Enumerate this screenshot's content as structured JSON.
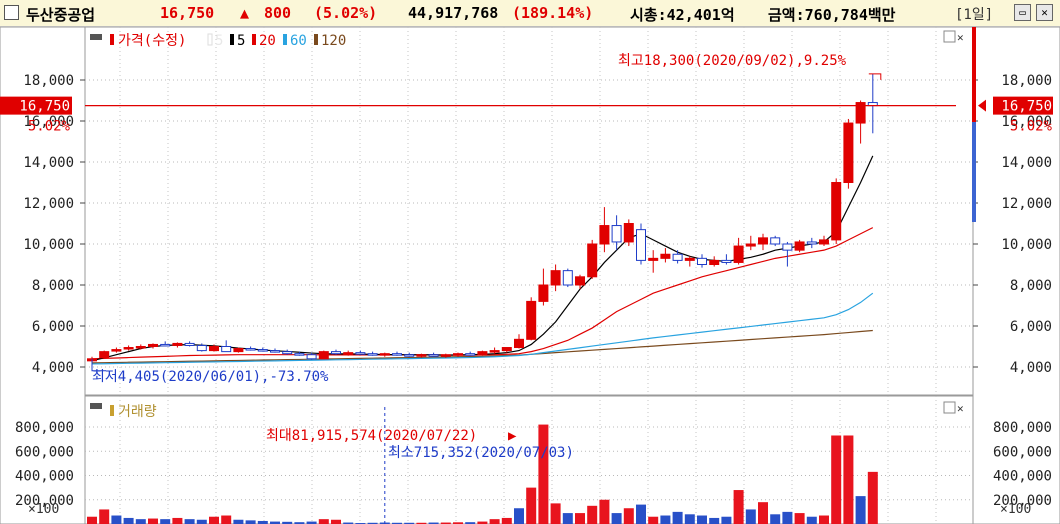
{
  "header": {
    "name": "두산중공업",
    "price": "16,750",
    "change_arrow": "▲",
    "change": "800",
    "change_pct": "(5.02%)",
    "volume": "44,917,768",
    "volume_ratio": "(189.14%)",
    "market_cap": "시총:42,401억",
    "amount": "금액:760,784백만",
    "period": "[1일]",
    "colors": {
      "up": "#e00000",
      "down": "#1e3cc8",
      "text": "#000000"
    }
  },
  "price_panel": {
    "legend": {
      "title": "가격(수정)",
      "ma": [
        {
          "label": "5",
          "color": "#ffffff"
        },
        {
          "label": "5",
          "color": "#000000"
        },
        {
          "label": "20",
          "color": "#e00000"
        },
        {
          "label": "60",
          "color": "#29a3e0"
        },
        {
          "label": "120",
          "color": "#7a4a1e"
        }
      ]
    },
    "y_ticks": [
      "18,000",
      "16,000",
      "14,000",
      "12,000",
      "10,000",
      "8,000",
      "6,000",
      "4,000"
    ],
    "current_price_label": "16,750",
    "current_pct_label": "5.02%",
    "high_annotation": "최고18,300(2020/09/02),9.25%",
    "low_annotation": "최저4,405(2020/06/01),-73.70%"
  },
  "volume_panel": {
    "legend": "거래량",
    "y_ticks": [
      "800,000",
      "600,000",
      "400,000",
      "200,000"
    ],
    "unit": "×100",
    "max_annotation": "최대81,915,574(2020/07/22)",
    "min_annotation": "최소715,352(2020/07/03)"
  },
  "chart_data": {
    "type": "candlestick",
    "ylim": [
      3500,
      19000
    ],
    "grid": true,
    "candles": [
      {
        "o": 4300,
        "h": 4500,
        "l": 4250,
        "c": 4400
      },
      {
        "o": 4450,
        "h": 4800,
        "l": 4400,
        "c": 4750
      },
      {
        "o": 4800,
        "h": 4950,
        "l": 4700,
        "c": 4850
      },
      {
        "o": 4900,
        "h": 5050,
        "l": 4800,
        "c": 4950
      },
      {
        "o": 4950,
        "h": 5100,
        "l": 4850,
        "c": 5000
      },
      {
        "o": 5000,
        "h": 5150,
        "l": 4900,
        "c": 5100
      },
      {
        "o": 5100,
        "h": 5250,
        "l": 5000,
        "c": 5050
      },
      {
        "o": 5050,
        "h": 5200,
        "l": 4950,
        "c": 5150
      },
      {
        "o": 5150,
        "h": 5250,
        "l": 5000,
        "c": 5050
      },
      {
        "o": 5050,
        "h": 5150,
        "l": 4750,
        "c": 4800
      },
      {
        "o": 4800,
        "h": 5100,
        "l": 4750,
        "c": 5000
      },
      {
        "o": 5000,
        "h": 5300,
        "l": 4950,
        "c": 4750
      },
      {
        "o": 4750,
        "h": 4950,
        "l": 4700,
        "c": 4900
      },
      {
        "o": 4900,
        "h": 5000,
        "l": 4800,
        "c": 4850
      },
      {
        "o": 4850,
        "h": 4950,
        "l": 4750,
        "c": 4800
      },
      {
        "o": 4800,
        "h": 4900,
        "l": 4700,
        "c": 4750
      },
      {
        "o": 4750,
        "h": 4850,
        "l": 4600,
        "c": 4650
      },
      {
        "o": 4650,
        "h": 4750,
        "l": 4550,
        "c": 4600
      },
      {
        "o": 4600,
        "h": 4700,
        "l": 4350,
        "c": 4400
      },
      {
        "o": 4400,
        "h": 4800,
        "l": 4380,
        "c": 4750
      },
      {
        "o": 4750,
        "h": 4850,
        "l": 4600,
        "c": 4650
      },
      {
        "o": 4650,
        "h": 4800,
        "l": 4550,
        "c": 4700
      },
      {
        "o": 4700,
        "h": 4800,
        "l": 4600,
        "c": 4650
      },
      {
        "o": 4650,
        "h": 4750,
        "l": 4550,
        "c": 4600
      },
      {
        "o": 4600,
        "h": 4700,
        "l": 4500,
        "c": 4650
      },
      {
        "o": 4650,
        "h": 4750,
        "l": 4550,
        "c": 4600
      },
      {
        "o": 4600,
        "h": 4700,
        "l": 4500,
        "c": 4550
      },
      {
        "o": 4550,
        "h": 4650,
        "l": 4450,
        "c": 4600
      },
      {
        "o": 4600,
        "h": 4700,
        "l": 4500,
        "c": 4550
      },
      {
        "o": 4550,
        "h": 4650,
        "l": 4450,
        "c": 4600
      },
      {
        "o": 4600,
        "h": 4700,
        "l": 4500,
        "c": 4650
      },
      {
        "o": 4650,
        "h": 4750,
        "l": 4550,
        "c": 4600
      },
      {
        "o": 4600,
        "h": 4800,
        "l": 4550,
        "c": 4750
      },
      {
        "o": 4750,
        "h": 4950,
        "l": 4650,
        "c": 4800
      },
      {
        "o": 4800,
        "h": 4900,
        "l": 4700,
        "c": 4950
      },
      {
        "o": 4950,
        "h": 5600,
        "l": 4900,
        "c": 5350
      },
      {
        "o": 5350,
        "h": 7400,
        "l": 5300,
        "c": 7200
      },
      {
        "o": 7200,
        "h": 8800,
        "l": 7000,
        "c": 8000
      },
      {
        "o": 8000,
        "h": 9000,
        "l": 7700,
        "c": 8700
      },
      {
        "o": 8700,
        "h": 8800,
        "l": 7900,
        "c": 8000
      },
      {
        "o": 8000,
        "h": 8500,
        "l": 7800,
        "c": 8400
      },
      {
        "o": 8400,
        "h": 10200,
        "l": 8300,
        "c": 10000
      },
      {
        "o": 10000,
        "h": 11800,
        "l": 9600,
        "c": 10900
      },
      {
        "o": 10900,
        "h": 11400,
        "l": 9700,
        "c": 10100
      },
      {
        "o": 10100,
        "h": 11200,
        "l": 9900,
        "c": 11000
      },
      {
        "o": 10700,
        "h": 11000,
        "l": 9000,
        "c": 9200
      },
      {
        "o": 9200,
        "h": 9700,
        "l": 8600,
        "c": 9300
      },
      {
        "o": 9300,
        "h": 9800,
        "l": 9100,
        "c": 9500
      },
      {
        "o": 9500,
        "h": 9700,
        "l": 9050,
        "c": 9200
      },
      {
        "o": 9200,
        "h": 9400,
        "l": 8900,
        "c": 9300
      },
      {
        "o": 9300,
        "h": 9500,
        "l": 8850,
        "c": 9000
      },
      {
        "o": 9000,
        "h": 9400,
        "l": 8900,
        "c": 9200
      },
      {
        "o": 9200,
        "h": 9500,
        "l": 9000,
        "c": 9100
      },
      {
        "o": 9100,
        "h": 10300,
        "l": 9000,
        "c": 9900
      },
      {
        "o": 9900,
        "h": 10400,
        "l": 9700,
        "c": 10000
      },
      {
        "o": 10000,
        "h": 10500,
        "l": 9700,
        "c": 10300
      },
      {
        "o": 10300,
        "h": 10400,
        "l": 9900,
        "c": 10000
      },
      {
        "o": 10000,
        "h": 10100,
        "l": 8900,
        "c": 9700
      },
      {
        "o": 9700,
        "h": 10200,
        "l": 9600,
        "c": 10100
      },
      {
        "o": 10100,
        "h": 10300,
        "l": 9800,
        "c": 10000
      },
      {
        "o": 10000,
        "h": 10400,
        "l": 9900,
        "c": 10200
      },
      {
        "o": 10200,
        "h": 13200,
        "l": 10000,
        "c": 13000
      },
      {
        "o": 13000,
        "h": 16100,
        "l": 12700,
        "c": 15900
      },
      {
        "o": 15900,
        "h": 17000,
        "l": 14900,
        "c": 16900
      },
      {
        "o": 16900,
        "h": 18300,
        "l": 15400,
        "c": 16750
      }
    ],
    "ma5": [
      4300,
      4450,
      4600,
      4750,
      4900,
      5000,
      5050,
      5080,
      5090,
      5060,
      5030,
      4980,
      4920,
      4880,
      4830,
      4790,
      4760,
      4720,
      4680,
      4650,
      4640,
      4640,
      4630,
      4620,
      4610,
      4600,
      4600,
      4590,
      4590,
      4580,
      4590,
      4600,
      4620,
      4650,
      4700,
      4800,
      5100,
      5600,
      6200,
      7000,
      7800,
      8400,
      9100,
      9700,
      10300,
      10500,
      10200,
      9900,
      9600,
      9400,
      9250,
      9200,
      9150,
      9250,
      9350,
      9500,
      9700,
      9800,
      9900,
      10000,
      10100,
      10600,
      11800,
      13000,
      14300
    ],
    "ma20": [
      4400,
      4420,
      4440,
      4460,
      4480,
      4500,
      4520,
      4540,
      4560,
      4570,
      4580,
      4590,
      4600,
      4600,
      4600,
      4600,
      4600,
      4600,
      4600,
      4590,
      4590,
      4590,
      4590,
      4590,
      4590,
      4590,
      4590,
      4590,
      4590,
      4580,
      4580,
      4580,
      4590,
      4600,
      4620,
      4650,
      4750,
      4900,
      5100,
      5300,
      5600,
      5900,
      6300,
      6700,
      7000,
      7300,
      7600,
      7800,
      8000,
      8200,
      8400,
      8550,
      8700,
      8850,
      9000,
      9150,
      9300,
      9400,
      9500,
      9600,
      9700,
      9900,
      10200,
      10500,
      10800
    ],
    "ma60": [
      4150,
      4160,
      4170,
      4180,
      4190,
      4200,
      4210,
      4220,
      4230,
      4240,
      4250,
      4260,
      4270,
      4280,
      4290,
      4300,
      4310,
      4320,
      4330,
      4340,
      4350,
      4360,
      4370,
      4380,
      4390,
      4400,
      4410,
      4420,
      4430,
      4440,
      4450,
      4460,
      4480,
      4500,
      4530,
      4560,
      4620,
      4700,
      4780,
      4860,
      4940,
      5020,
      5100,
      5180,
      5260,
      5340,
      5420,
      5490,
      5560,
      5630,
      5700,
      5770,
      5840,
      5910,
      5980,
      6050,
      6120,
      6190,
      6260,
      6330,
      6400,
      6550,
      6800,
      7150,
      7600
    ],
    "ma120": [
      4200,
      4210,
      4220,
      4230,
      4240,
      4250,
      4260,
      4270,
      4280,
      4290,
      4300,
      4310,
      4320,
      4330,
      4340,
      4350,
      4360,
      4370,
      4380,
      4390,
      4400,
      4410,
      4420,
      4430,
      4440,
      4450,
      4460,
      4470,
      4480,
      4490,
      4500,
      4510,
      4520,
      4540,
      4560,
      4580,
      4620,
      4660,
      4700,
      4740,
      4780,
      4820,
      4860,
      4900,
      4940,
      4980,
      5020,
      5060,
      5100,
      5140,
      5180,
      5220,
      5260,
      5300,
      5340,
      5380,
      5420,
      5460,
      5500,
      5540,
      5580,
      5630,
      5680,
      5730,
      5780
    ],
    "volume_ylim": [
      0,
      900000
    ],
    "volume": [
      {
        "v": 60000,
        "up": true
      },
      {
        "v": 120000,
        "up": true
      },
      {
        "v": 70000,
        "up": false
      },
      {
        "v": 50000,
        "up": false
      },
      {
        "v": 40000,
        "up": false
      },
      {
        "v": 45000,
        "up": true
      },
      {
        "v": 40000,
        "up": false
      },
      {
        "v": 50000,
        "up": true
      },
      {
        "v": 40000,
        "up": false
      },
      {
        "v": 35000,
        "up": false
      },
      {
        "v": 60000,
        "up": true
      },
      {
        "v": 70000,
        "up": true
      },
      {
        "v": 35000,
        "up": false
      },
      {
        "v": 30000,
        "up": false
      },
      {
        "v": 25000,
        "up": false
      },
      {
        "v": 20000,
        "up": false
      },
      {
        "v": 18000,
        "up": false
      },
      {
        "v": 15000,
        "up": false
      },
      {
        "v": 20000,
        "up": false
      },
      {
        "v": 40000,
        "up": true
      },
      {
        "v": 35000,
        "up": true
      },
      {
        "v": 12000,
        "up": false
      },
      {
        "v": 8000,
        "up": false
      },
      {
        "v": 10000,
        "up": false
      },
      {
        "v": 12000,
        "up": false
      },
      {
        "v": 10000,
        "up": false
      },
      {
        "v": 10000,
        "up": false
      },
      {
        "v": 10000,
        "up": true
      },
      {
        "v": 12000,
        "up": false
      },
      {
        "v": 12000,
        "up": true
      },
      {
        "v": 14000,
        "up": true
      },
      {
        "v": 15000,
        "up": false
      },
      {
        "v": 20000,
        "up": true
      },
      {
        "v": 40000,
        "up": true
      },
      {
        "v": 50000,
        "up": true
      },
      {
        "v": 130000,
        "up": false
      },
      {
        "v": 300000,
        "up": true
      },
      {
        "v": 820000,
        "up": true
      },
      {
        "v": 170000,
        "up": true
      },
      {
        "v": 90000,
        "up": false
      },
      {
        "v": 90000,
        "up": true
      },
      {
        "v": 150000,
        "up": true
      },
      {
        "v": 200000,
        "up": true
      },
      {
        "v": 90000,
        "up": false
      },
      {
        "v": 130000,
        "up": true
      },
      {
        "v": 160000,
        "up": false
      },
      {
        "v": 60000,
        "up": true
      },
      {
        "v": 70000,
        "up": false
      },
      {
        "v": 100000,
        "up": false
      },
      {
        "v": 80000,
        "up": false
      },
      {
        "v": 70000,
        "up": false
      },
      {
        "v": 50000,
        "up": false
      },
      {
        "v": 60000,
        "up": false
      },
      {
        "v": 280000,
        "up": true
      },
      {
        "v": 120000,
        "up": false
      },
      {
        "v": 180000,
        "up": true
      },
      {
        "v": 80000,
        "up": false
      },
      {
        "v": 100000,
        "up": false
      },
      {
        "v": 90000,
        "up": true
      },
      {
        "v": 60000,
        "up": false
      },
      {
        "v": 70000,
        "up": true
      },
      {
        "v": 730000,
        "up": true
      },
      {
        "v": 730000,
        "up": true
      },
      {
        "v": 230000,
        "up": false
      },
      {
        "v": 430000,
        "up": true
      }
    ],
    "current_price": 16750,
    "high_index": 64,
    "low_index": 0,
    "max_volume_index": 37,
    "min_volume_index": 24
  }
}
